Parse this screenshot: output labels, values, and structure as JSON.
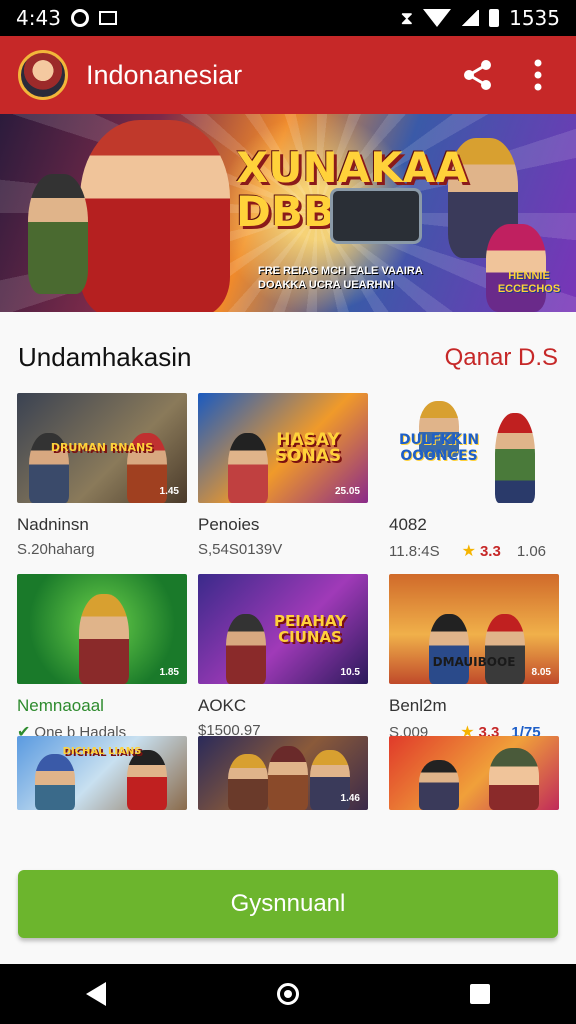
{
  "status_bar": {
    "time": "4:43",
    "battery": "1535"
  },
  "app_bar": {
    "title": "Indonanesiar",
    "share_icon": "share-icon",
    "menu_icon": "more-vert-icon",
    "accent": "#c62828"
  },
  "banner": {
    "title_line1": "XUNAKAA",
    "title_line2": "DBB",
    "tagline": "FRE REIAG MCH EALE VAAIRA DOAKKA UCRA UEARHN!",
    "badge": "HENNIE ECCECHOS"
  },
  "section": {
    "title": "Undamhakasin",
    "link": "Qanar D.S"
  },
  "games": [
    {
      "thumb_text": "DRUMAN RNANS",
      "corner": "1.45",
      "name": "Nadninsn",
      "meta": "S.20haharg"
    },
    {
      "thumb_text": "HASAY SONAS",
      "corner": "25.05",
      "name": "Penoies",
      "meta": "S,54S0139V"
    },
    {
      "thumb_text": "DULFKKIN OOONCES",
      "corner": "",
      "name": "4082",
      "meta": "11.8:4S",
      "rating": "3.3",
      "extra": "1.06"
    },
    {
      "thumb_text": "",
      "corner": "1.85",
      "name": "Nemnaoaal",
      "meta": "One b Hadals",
      "check": true
    },
    {
      "thumb_text": "PEIAHAY CIUNAS",
      "corner": "10.5",
      "name": "AOKC",
      "meta": "$1500.97"
    },
    {
      "thumb_text": "DMAUIBOOE",
      "corner": "8.05",
      "name": "Benl2m",
      "meta": "S.009",
      "rating": "3.3",
      "extra": "1/75"
    },
    {
      "thumb_text": "DICHAL LIANS",
      "corner": "",
      "name": "",
      "meta": ""
    },
    {
      "thumb_text": "",
      "corner": "1.46",
      "name": "",
      "meta": ""
    },
    {
      "thumb_text": "",
      "corner": "",
      "name": "",
      "meta": ""
    }
  ],
  "cta": {
    "label": "Gysnnuanl",
    "color": "#6cb52d"
  },
  "nav": {
    "back_icon": "back-icon",
    "home_icon": "home-icon",
    "recents_icon": "recents-icon"
  }
}
